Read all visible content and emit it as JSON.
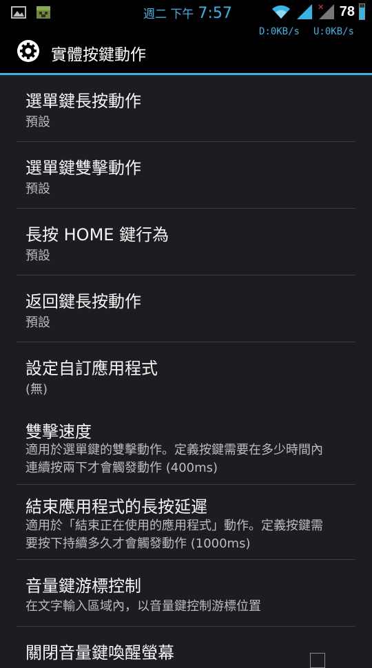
{
  "status_bar": {
    "day": "週二 下午",
    "time": "7:57",
    "battery": "78",
    "battery_level": 0.78,
    "download": "D:0KB/s",
    "upload": "U:0KB/s"
  },
  "action_bar": {
    "title": "實體按鍵動作",
    "icon": "gear-icon"
  },
  "items": [
    {
      "title": "選單鍵長按動作",
      "summary": "預設"
    },
    {
      "title": "選單鍵雙擊動作",
      "summary": "預設"
    },
    {
      "title": "長按 HOME 鍵行為",
      "summary": "預設"
    },
    {
      "title": "返回鍵長按動作",
      "summary": "預設"
    },
    {
      "title": "設定自訂應用程式",
      "summary": "(無)"
    },
    {
      "title": "雙擊速度",
      "summary": "適用於選單鍵的雙擊動作。定義按鍵需要在多少時間內連續按兩下才會觸發動作 (400ms)"
    },
    {
      "title": "結束應用程式的長按延遲",
      "summary": "適用於「結束正在使用的應用程式」動作。定義按鍵需要按下持續多久才會觸發動作 (1000ms)"
    },
    {
      "title": "音量鍵游標控制",
      "summary": "在文字輸入區域內，以音量鍵控制游標位置"
    },
    {
      "title": "關閉音量鍵喚醒螢幕",
      "summary": ""
    }
  ],
  "colors": {
    "accent": "#33b5e5",
    "background": "#1b1d20"
  }
}
